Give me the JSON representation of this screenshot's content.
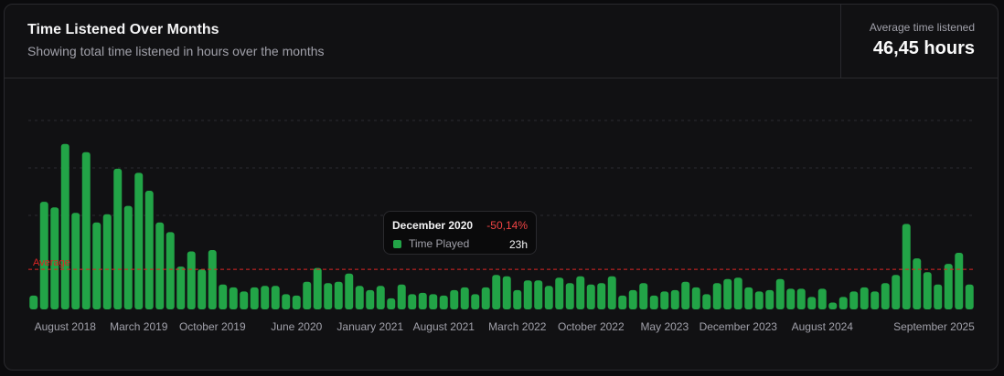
{
  "header": {
    "title": "Time Listened Over Months",
    "subtitle": "Showing total time listened in hours over the months"
  },
  "stat": {
    "label": "Average time listened",
    "value": "46,45 hours"
  },
  "tooltip": {
    "month": "December 2020",
    "change": "-50,14%",
    "series": "Time Played",
    "value": "23h"
  },
  "colors": {
    "bar": "#22a447",
    "average_line": "#dc2626",
    "grid": "#2c2c30",
    "tick": "#a1a1aa"
  },
  "chart_data": {
    "type": "bar",
    "start_month": "2018-05",
    "x_tick_labels": [
      "August 2018",
      "March 2019",
      "October 2019",
      "June 2020",
      "January 2021",
      "August 2021",
      "March 2022",
      "October 2022",
      "May 2023",
      "December 2023",
      "August 2024",
      "September 2025"
    ],
    "values": [
      10,
      78,
      74,
      120,
      70,
      114,
      63,
      69,
      102,
      75,
      99,
      86,
      63,
      56,
      31,
      42,
      29,
      43,
      18,
      16,
      13,
      16,
      17,
      17,
      11,
      10,
      20,
      30,
      19,
      20,
      26,
      17,
      14,
      17,
      8,
      18,
      11,
      12,
      11,
      10,
      14,
      16,
      11,
      16,
      25,
      24,
      14,
      21,
      21,
      17,
      23,
      19,
      24,
      18,
      19,
      24,
      10,
      14,
      19,
      10,
      13,
      14,
      20,
      16,
      11,
      19,
      22,
      23,
      16,
      13,
      14,
      22,
      15,
      15,
      9,
      15,
      5,
      9,
      13,
      16,
      13,
      19,
      25,
      62,
      37,
      27,
      18,
      33,
      41,
      18
    ],
    "average": 29,
    "average_label": "Average",
    "ylim": [
      0,
      137
    ],
    "grid": true,
    "legend": "none"
  }
}
